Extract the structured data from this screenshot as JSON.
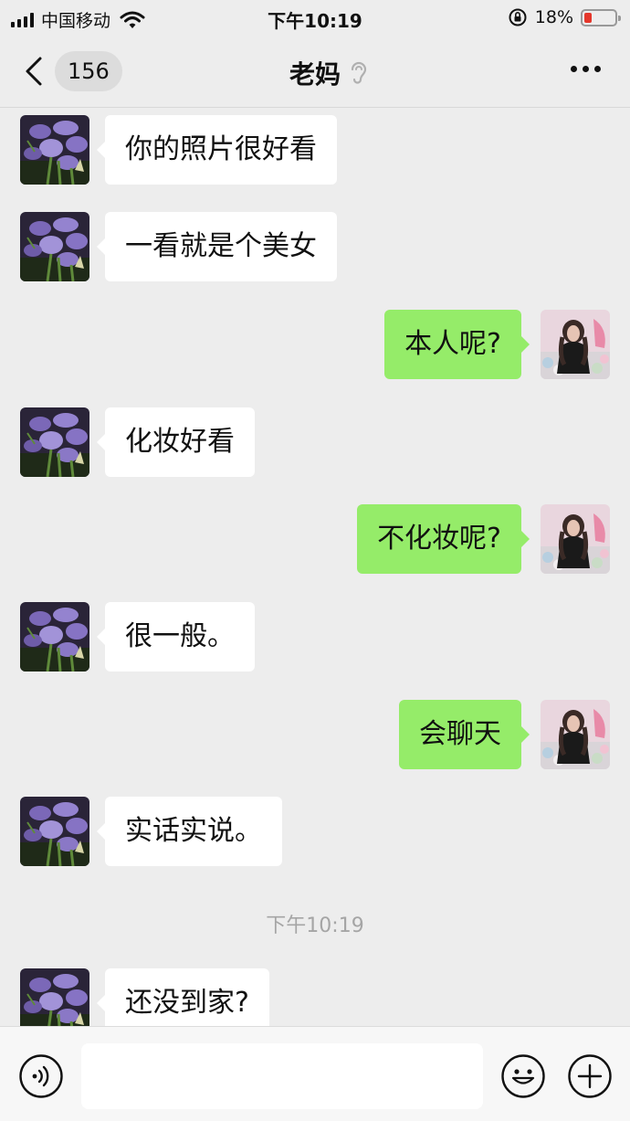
{
  "status_bar": {
    "carrier": "中国移动",
    "time": "下午10:19",
    "battery_percent": "18%",
    "battery_level": 0.18,
    "icons": [
      "signal-icon",
      "wifi-icon",
      "rotation-lock-icon",
      "battery-icon"
    ]
  },
  "nav": {
    "unread_count": "156",
    "title": "老妈",
    "icons": [
      "back-chevron-icon",
      "ear-icon",
      "more-icon"
    ]
  },
  "messages": [
    {
      "side": "in",
      "text": "你的照片很好看"
    },
    {
      "side": "in",
      "text": "一看就是个美女"
    },
    {
      "side": "out",
      "text": "本人呢?"
    },
    {
      "side": "in",
      "text": "化妆好看"
    },
    {
      "side": "out",
      "text": "不化妆呢?"
    },
    {
      "side": "in",
      "text": "很一般。"
    },
    {
      "side": "out",
      "text": "会聊天"
    },
    {
      "side": "in",
      "text": "实话实说。"
    },
    {
      "side": "in",
      "text": "还没到家?"
    }
  ],
  "timestamp": "下午10:19",
  "input_bar": {
    "icons": [
      "voice-icon",
      "emoji-icon",
      "plus-icon"
    ],
    "text_value": ""
  },
  "colors": {
    "background": "#ededed",
    "outgoing_bubble": "#95ec69",
    "incoming_bubble": "#ffffff",
    "battery_low": "#e5372b"
  }
}
